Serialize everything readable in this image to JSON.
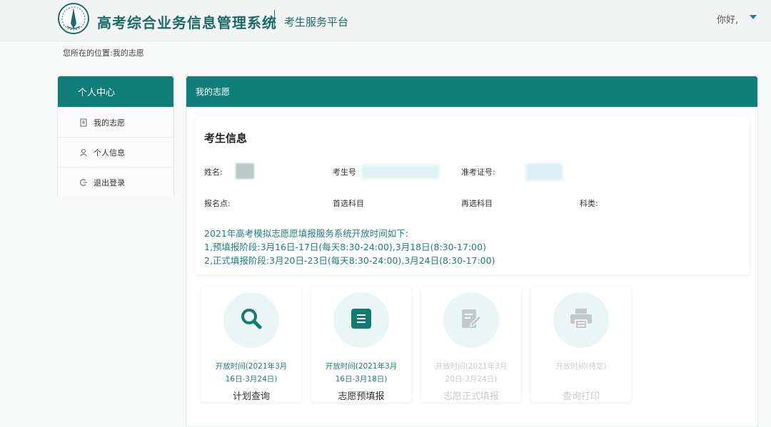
{
  "header": {
    "title": "高考综合业务信息管理系统",
    "platform": "考生服务平台",
    "greeting": "你好,"
  },
  "breadcrumb": {
    "prefix": "您所在的位置:",
    "current": "我的志愿"
  },
  "sidebar": {
    "title": "个人中心",
    "items": [
      {
        "label": "我的志愿",
        "icon": "document-icon"
      },
      {
        "label": "个人信息",
        "icon": "user-icon"
      },
      {
        "label": "退出登录",
        "icon": "logout-icon"
      }
    ]
  },
  "main": {
    "title": "我的志愿",
    "student_info": {
      "title": "考生信息",
      "fields": {
        "name_label": "姓名:",
        "exam_no_label": "考生号",
        "admission_no_label": "准考证号:",
        "site_label": "报名点:",
        "first_subject_label": "首选科目",
        "second_subject_label": "再选科目",
        "category_label": "科类:"
      }
    },
    "notice": [
      "2021年高考模拟志愿愿填报服务系统开放时间如下:",
      "1,预填报阶段:3月16日-17日(每天8:30-24:00),3月18日(8:30-17:00)",
      "2,正式填报阶段:3月20日-23日(每天8:30-24:00),3月24日(8:30-17:00)"
    ]
  },
  "cards": [
    {
      "name": "计划查询",
      "time1": "开放时间(2021年3月",
      "time2": "16日-3月24日)",
      "icon": "search-icon",
      "enabled": true
    },
    {
      "name": "志愿预填报",
      "time1": "开放时间(2021年3月",
      "time2": "16日-3月18日)",
      "icon": "form-icon",
      "enabled": true
    },
    {
      "name": "志愿正式填报",
      "time1": "开放时间(2021年3月",
      "time2": "20日-3月24日)",
      "icon": "edit-icon",
      "enabled": false
    },
    {
      "name": "查询打印",
      "time1": "开放时间(待定)",
      "time2": "",
      "icon": "printer-icon",
      "enabled": false
    }
  ],
  "colors": {
    "primary": "#127e7a",
    "accent_text": "#1f7f78",
    "disabled": "#c9cccc"
  }
}
